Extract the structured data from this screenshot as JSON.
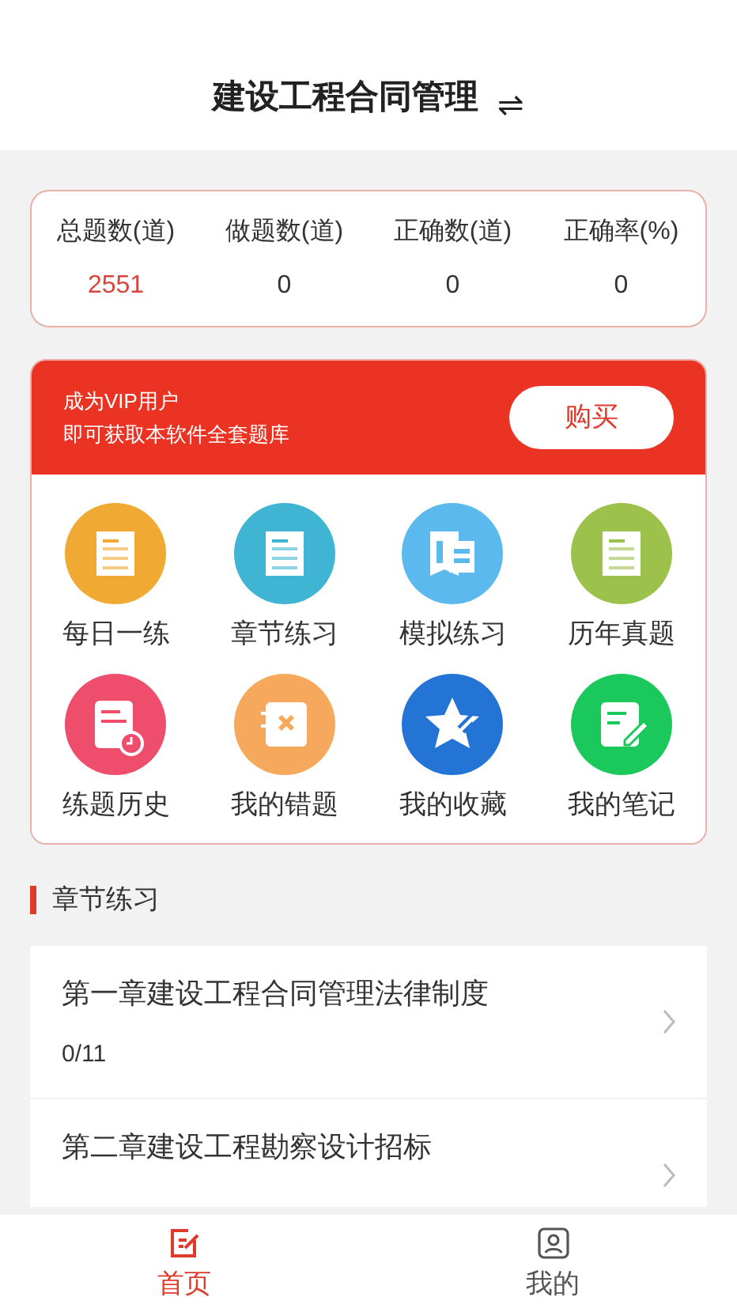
{
  "header": {
    "title": "建设工程合同管理",
    "switch_icon": "⇌"
  },
  "stats": [
    {
      "label": "总题数(道)",
      "value": "2551",
      "highlight": true
    },
    {
      "label": "做题数(道)",
      "value": "0",
      "highlight": false
    },
    {
      "label": "正确数(道)",
      "value": "0",
      "highlight": false
    },
    {
      "label": "正确率(%)",
      "value": "0",
      "highlight": false
    }
  ],
  "vip_banner": {
    "line_1": "成为VIP用户",
    "line_2": "即可获取本软件全套题库",
    "button": "购买"
  },
  "features": [
    {
      "label": "每日一练",
      "color": "#f0a932",
      "kind": "doc"
    },
    {
      "label": "章节练习",
      "color": "#3fb5d3",
      "kind": "doc"
    },
    {
      "label": "模拟练习",
      "color": "#5cb9ee",
      "kind": "sheet"
    },
    {
      "label": "历年真题",
      "color": "#9dc24c",
      "kind": "doc"
    },
    {
      "label": "练题历史",
      "color": "#ee4d6b",
      "kind": "history"
    },
    {
      "label": "我的错题",
      "color": "#f6a95c",
      "kind": "wrong"
    },
    {
      "label": "我的收藏",
      "color": "#2474d6",
      "kind": "star"
    },
    {
      "label": "我的笔记",
      "color": "#1bc85b",
      "kind": "note"
    }
  ],
  "section": {
    "title": "章节练习"
  },
  "chapters": [
    {
      "title": "第一章建设工程合同管理法律制度",
      "progress": "0/11"
    },
    {
      "title": "第二章建设工程勘察设计招标"
    }
  ],
  "tab_bar": [
    {
      "label": "首页",
      "selected": true,
      "kind": "home"
    },
    {
      "label": "我的",
      "selected": false,
      "kind": "profile"
    }
  ]
}
